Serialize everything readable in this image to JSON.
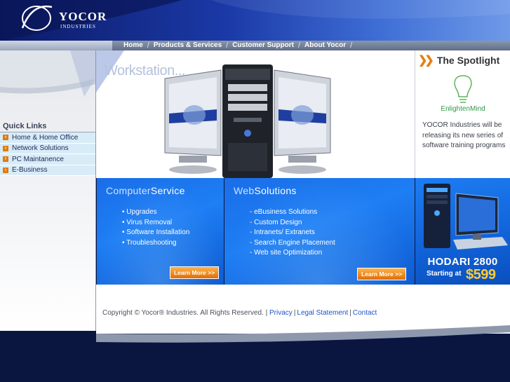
{
  "brand": {
    "name": "YOCOR",
    "subtitle": "INDUSTRIES"
  },
  "nav": {
    "items": [
      {
        "label": "Home"
      },
      {
        "label": "Products & Services"
      },
      {
        "label": "Customer Support"
      },
      {
        "label": "About Yocor"
      }
    ]
  },
  "quick_links": {
    "title": "Quick Links",
    "items": [
      {
        "label": "Home & Home Office"
      },
      {
        "label": "Network Solutions"
      },
      {
        "label": "PC Maintanence"
      },
      {
        "label": "E-Business"
      }
    ]
  },
  "hero": {
    "title": "Workstation..."
  },
  "spotlight": {
    "title": "The Spotlight",
    "brand": "EnlightenMind",
    "text": "YOCOR Industries will be releasing its new series of software training programs"
  },
  "computer_service": {
    "title_a": "Computer",
    "title_b": "Service",
    "items": [
      "• Upgrades",
      "• Virus Removal",
      "• Software Installation",
      "• Troubleshooting"
    ],
    "button": "Learn More >>"
  },
  "web_solutions": {
    "title_a": "Web",
    "title_b": "Solutions",
    "items": [
      "- eBusiness Solutions",
      "- Custom Design",
      "- Intranets/ Extranets",
      "- Search Engine Placement",
      "- Web site Optimization"
    ],
    "button": "Learn More >>"
  },
  "ad": {
    "name": "HODARI 2800",
    "starting": "Starting at",
    "price": "$599"
  },
  "footer": {
    "copyright": "Copyright © Yocor® Industries. All Rights Reserved. |",
    "links": [
      {
        "label": "Privacy"
      },
      {
        "label": "Legal Statement"
      },
      {
        "label": "Contact"
      }
    ]
  },
  "colors": {
    "header_dark": "#0b1a66",
    "accent_orange": "#e07c12",
    "panel_blue": "#1a6ee8",
    "link_blue": "#1f52c4"
  }
}
